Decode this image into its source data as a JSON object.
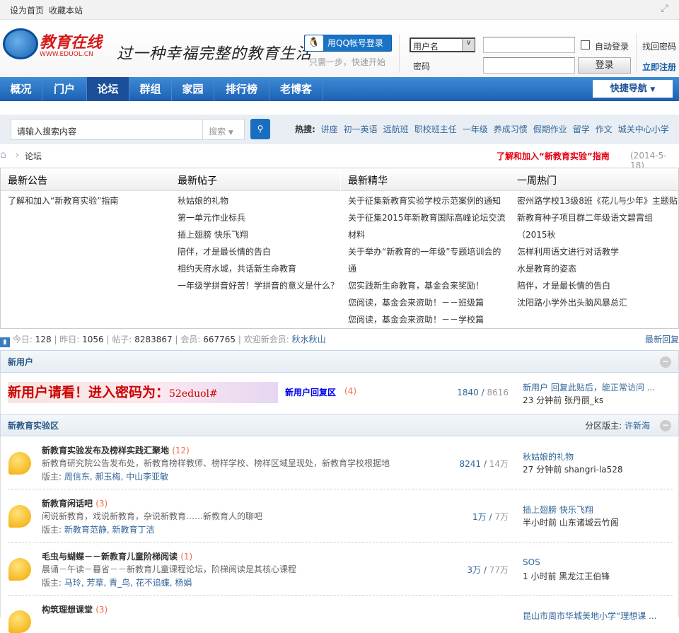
{
  "topbar": {
    "set_home": "设为首页",
    "bookmark": "收藏本站"
  },
  "header": {
    "logo_text": "教育在线",
    "logo_url": "WWW.EDUOL.CN",
    "slogan": "过一种幸福完整的教育生活",
    "qq_login": "用QQ帐号登录",
    "qq_hint": "只需一步，快速开始",
    "username_select": "用户名",
    "password_label": "密码",
    "auto_login": "自动登录",
    "login_button": "登录",
    "find_password": "找回密码",
    "register": "立即注册"
  },
  "nav": {
    "items": [
      "概况",
      "门户",
      "论坛",
      "群组",
      "家园",
      "排行榜",
      "老博客"
    ],
    "active": "论坛",
    "quick_nav": "快捷导航"
  },
  "search": {
    "placeholder": "请输入搜索内容",
    "type": "搜索",
    "hot_label": "热搜:",
    "hot": [
      "讲座",
      "初一英语",
      "远航班",
      "职校班主任",
      "一年级",
      "养成习惯",
      "假期作业",
      "留学",
      "作文",
      "城关中心小学"
    ]
  },
  "breadcrumb": {
    "current": "论坛",
    "notice_link": "了解和加入“新教育实验”指南",
    "notice_date": "(2014-5-18)"
  },
  "announcements": {
    "columns": [
      {
        "title": "最新公告",
        "items": [
          "了解和加入“新教育实验”指南"
        ]
      },
      {
        "title": "最新帖子",
        "items": [
          "秋姑娘的礼物",
          "第一单元作业标兵",
          "插上翅膀 快乐飞翔",
          "陪伴，才是最长情的告白",
          "相约天府水城，共话新生命教育",
          "一年级学拼音好苦！学拼音的意义是什么？"
        ]
      },
      {
        "title": "最新精华",
        "items": [
          "关于征集新教育实验学校示范案例的通知",
          "关于征集2015年新教育国际高峰论坛交流",
          "材料",
          "关于举办“新教育的一年级”专题培训会的",
          "通",
          "您实践新生命教育，基金会来奖励！",
          "您阅读，基金会来资助！－－班级篇",
          "您阅读，基金会来资助！－－学校篇"
        ]
      },
      {
        "title": "一周热门",
        "items": [
          "密州路学校13级8班《花儿与少年》主题贴",
          "新教育种子项目群二年级语文碧霄组",
          "（2015秋",
          "怎样利用语文进行对话教学",
          "水是教育的姿态",
          "陪伴，才是最长情的告白",
          "沈阳路小学外出头脑风暴总汇"
        ]
      }
    ]
  },
  "stats": {
    "today_label": "今日:",
    "today": "128",
    "yesterday_label": "昨日:",
    "yesterday": "1056",
    "posts_label": "帖子:",
    "posts": "8283867",
    "members_label": "会员:",
    "members": "667765",
    "welcome_label": "欢迎新会员:",
    "new_member": "秋水秋山",
    "latest_reply": "最新回复"
  },
  "new_user_section": {
    "title": "新用户",
    "banner_text": "新用户请看！进入密码为：",
    "banner_code": "52eduol#",
    "forum": "新用户回复区",
    "count": "(4)",
    "threads": "1840",
    "posts": "8616",
    "last_title": "新用户 回复此贴后，能正常访问 ...",
    "last_time": "23 分钟前",
    "last_user": "张丹丽_ks"
  },
  "exp_section": {
    "title": "新教育实验区",
    "moderator_label": "分区版主:",
    "moderator": "许新海",
    "forums": [
      {
        "name": "新教育实验发布及榜样实践汇聚地",
        "count": "(12)",
        "desc": "新教育研究院公告发布处，新教育榜样教师、榜样学校、榜样区域呈现处，新教育学校根据地",
        "mod_label": "版主:",
        "mods": "周信东, 郝玉梅, 中山李亚敏",
        "threads": "8241",
        "posts": "14万",
        "last_title": "秋姑娘的礼物",
        "last_time": "27 分钟前",
        "last_user": "shangri-la528"
      },
      {
        "name": "新教育闲话吧",
        "count": "(3)",
        "desc": "闲说新教育，戏说新教育，杂说新教育……新教育人的聊吧",
        "mod_label": "版主:",
        "mods": "新教育范静, 新教育丁洁",
        "threads": "1万",
        "posts": "7万",
        "last_title": "插上翅膀 快乐飞翔",
        "last_time": "半小时前",
        "last_user": "山东诸城云竹阁"
      },
      {
        "name": "毛虫与蝴蝶－－新教育儿童阶梯阅读",
        "count": "(1)",
        "desc": "晨诵－午读－暮省－－新教育儿童课程论坛，阶梯阅读是其核心课程",
        "mod_label": "版主:",
        "mods": "马玲, 芳草, 青_鸟, 花不追蝶, 杨娟",
        "threads": "3万",
        "posts": "77万",
        "last_title": "SOS",
        "last_time": "1 小时前",
        "last_user": "黑龙江王伯锋"
      },
      {
        "name": "构筑理想课堂",
        "count": "(3)",
        "desc": "",
        "mod_label": "",
        "mods": "",
        "threads": "",
        "posts": "",
        "last_title": "昆山市周市华城美地小学“理想课 ...",
        "last_time": "",
        "last_user": ""
      }
    ]
  },
  "colors": {
    "nav": "#1d62b5",
    "link": "#336699",
    "count": "#f26c4f",
    "notice": "#e60012"
  }
}
